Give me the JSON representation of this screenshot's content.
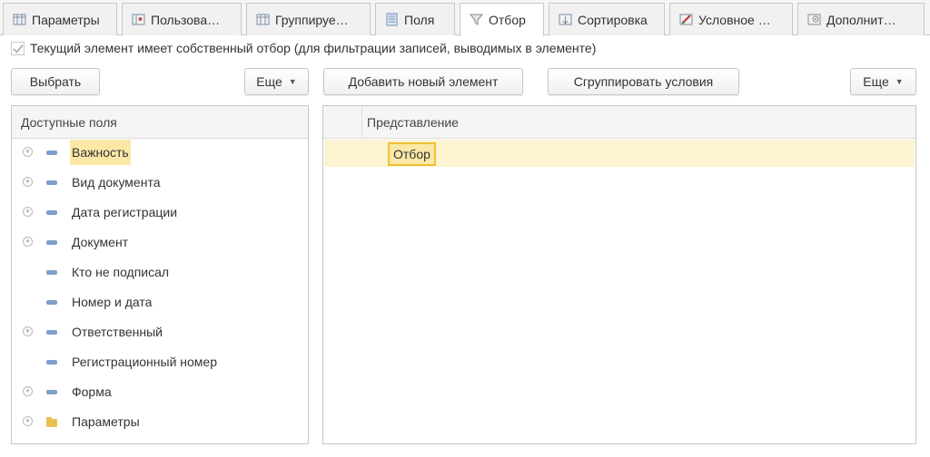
{
  "tabs": [
    {
      "label": "Параметры",
      "icon": "params-icon"
    },
    {
      "label": "Пользова…",
      "icon": "user-fields-icon"
    },
    {
      "label": "Группируе…",
      "icon": "grouping-icon"
    },
    {
      "label": "Поля",
      "icon": "fields-icon"
    },
    {
      "label": "Отбор",
      "icon": "filter-icon",
      "active": true
    },
    {
      "label": "Сортировка",
      "icon": "sort-icon"
    },
    {
      "label": "Условное …",
      "icon": "conditional-format-icon"
    },
    {
      "label": "Дополнит…",
      "icon": "additional-icon"
    }
  ],
  "own_filter_checkbox": {
    "label": "Текущий элемент имеет собственный отбор (для фильтрации записей, выводимых в элементе)"
  },
  "left_toolbar": {
    "select_label": "Выбрать",
    "more_label": "Еще"
  },
  "right_toolbar": {
    "add_label": "Добавить новый элемент",
    "group_label": "Сгруппировать условия",
    "more_label": "Еще"
  },
  "available_fields": {
    "header": "Доступные поля",
    "items": [
      {
        "label": "Важность",
        "expandable": true,
        "icon": "field-icon",
        "selected": true
      },
      {
        "label": "Вид документа",
        "expandable": true,
        "icon": "field-icon"
      },
      {
        "label": "Дата регистрации",
        "expandable": true,
        "icon": "field-icon"
      },
      {
        "label": "Документ",
        "expandable": true,
        "icon": "field-icon"
      },
      {
        "label": "Кто не подписал",
        "expandable": false,
        "icon": "field-icon"
      },
      {
        "label": "Номер и дата",
        "expandable": false,
        "icon": "field-icon"
      },
      {
        "label": "Ответственный",
        "expandable": true,
        "icon": "field-icon"
      },
      {
        "label": "Регистрационный номер",
        "expandable": false,
        "icon": "field-icon"
      },
      {
        "label": "Форма",
        "expandable": true,
        "icon": "field-icon"
      },
      {
        "label": "Параметры",
        "expandable": true,
        "icon": "folder-icon"
      }
    ]
  },
  "filter_grid": {
    "header": "Представление",
    "rows": [
      {
        "label": "Отбор"
      }
    ]
  },
  "colors": {
    "selection": "#fbe8a6",
    "active_cell_border": "#f2c037",
    "row_highlight": "#fcf4d1"
  }
}
